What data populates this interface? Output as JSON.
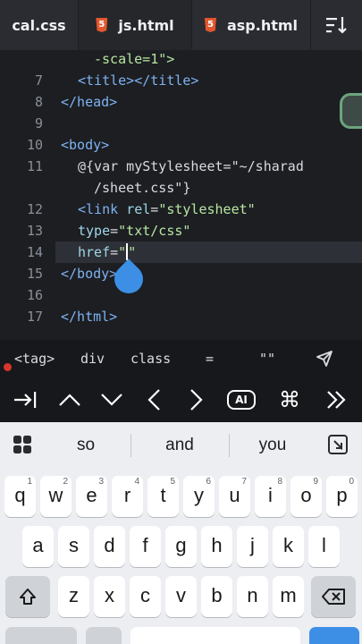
{
  "tabs": [
    {
      "label": "cal.css",
      "icon": ""
    },
    {
      "label": "js.html",
      "icon": "html5-icon"
    },
    {
      "label": "asp.html",
      "icon": "html5-icon"
    }
  ],
  "sort_icon": "sort-lines-icon",
  "editor": {
    "lines": [
      {
        "num": "",
        "parts": [
          {
            "t": "-scale=1\">",
            "c": "str"
          }
        ]
      },
      {
        "num": "7",
        "parts": [
          {
            "t": "<title></title>",
            "c": "tag"
          }
        ]
      },
      {
        "num": "8",
        "parts": [
          {
            "t": "</head>",
            "c": "tag"
          }
        ]
      },
      {
        "num": "9",
        "parts": []
      },
      {
        "num": "10",
        "parts": [
          {
            "t": "<body>",
            "c": "tag"
          }
        ]
      },
      {
        "num": "11",
        "parts": [
          {
            "t": "@{var myStylesheet=\"~/sharad",
            "c": "plain"
          }
        ]
      },
      {
        "num": "",
        "parts": [
          {
            "t": "/sheet.css\"}",
            "c": "plain"
          }
        ]
      },
      {
        "num": "12",
        "parts": [
          {
            "t": "<link ",
            "c": "tag"
          },
          {
            "t": "rel",
            "c": "attr"
          },
          {
            "t": "=",
            "c": "plain"
          },
          {
            "t": "\"stylesheet\"",
            "c": "str"
          }
        ]
      },
      {
        "num": "13",
        "parts": [
          {
            "t": "type",
            "c": "attr"
          },
          {
            "t": "=",
            "c": "plain"
          },
          {
            "t": "\"txt/css\"",
            "c": "str"
          }
        ]
      },
      {
        "num": "14",
        "parts": [
          {
            "t": "href",
            "c": "attr"
          },
          {
            "t": "=",
            "c": "plain"
          },
          {
            "t": "\"",
            "c": "str"
          },
          {
            "t": "|caret|",
            "c": "caret"
          },
          {
            "t": "\"",
            "c": "str"
          }
        ]
      },
      {
        "num": "15",
        "parts": [
          {
            "t": "</body>",
            "c": "tag"
          }
        ]
      },
      {
        "num": "16",
        "parts": []
      },
      {
        "num": "17",
        "parts": [
          {
            "t": "</html>",
            "c": "tag"
          }
        ]
      }
    ],
    "current_line": "14"
  },
  "snippets": [
    "<tag>",
    "div",
    "class",
    "=",
    "\"\""
  ],
  "nav_icons": [
    "tab-indent-icon",
    "arrow-up-icon",
    "arrow-down-icon",
    "arrow-left-icon",
    "arrow-right-icon",
    "ai-icon",
    "command-icon",
    "double-chevron-right-icon"
  ],
  "ai_label": "AI",
  "keyboard": {
    "suggestions": [
      "so",
      "and",
      "you"
    ],
    "row1": [
      {
        "k": "q",
        "h": "1"
      },
      {
        "k": "w",
        "h": "2"
      },
      {
        "k": "e",
        "h": "3"
      },
      {
        "k": "r",
        "h": "4"
      },
      {
        "k": "t",
        "h": "5"
      },
      {
        "k": "y",
        "h": "6"
      },
      {
        "k": "u",
        "h": "7"
      },
      {
        "k": "i",
        "h": "8"
      },
      {
        "k": "o",
        "h": "9"
      },
      {
        "k": "p",
        "h": "0"
      }
    ],
    "row2": [
      "a",
      "s",
      "d",
      "f",
      "g",
      "h",
      "j",
      "k",
      "l"
    ],
    "row3": [
      "z",
      "x",
      "c",
      "v",
      "b",
      "n",
      "m"
    ]
  },
  "colors": {
    "accent": "#3d8fe6",
    "html5": "#e4572e",
    "editor_bg": "#1c1e22"
  }
}
